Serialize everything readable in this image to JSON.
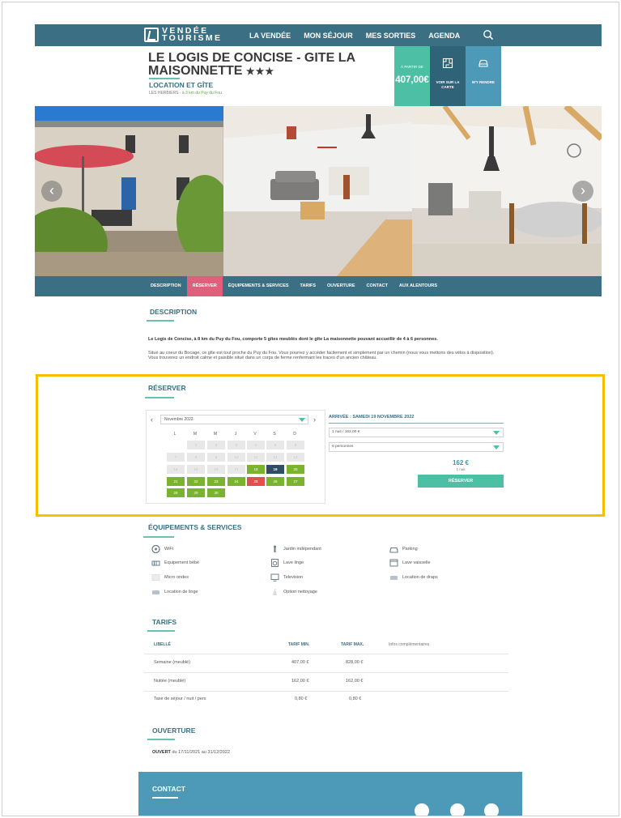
{
  "nav": {
    "logo_line1": "VENDÉE",
    "logo_line2": "TOURISME",
    "items": [
      "LA VENDÉE",
      "MON SÉJOUR",
      "MES SORTIES",
      "AGENDA"
    ]
  },
  "header": {
    "title": "LE LOGIS DE CONCISE - GITE LA MAISONNETTE",
    "stars": "★★★",
    "category": "LOCATION ET GÎTE",
    "location": "LES HERBIERS",
    "distance": " - à 3 km du Puy du Fou"
  },
  "boxes": {
    "price_label": "À PARTIR DE",
    "price_value": "407,00€",
    "map_label": "VOIR SUR LA CARTE",
    "go_label": "M'Y RENDRE"
  },
  "tabs": [
    "DESCRIPTION",
    "RÉSERVER",
    "ÉQUIPEMENTS & SERVICES",
    "TARIFS",
    "OUVERTURE",
    "CONTACT",
    "AUX ALENTOURS"
  ],
  "description": {
    "title": "DESCRIPTION",
    "lead": "Le Logis de Concise, à 8 km du Puy du Fou, comporte 5 gîtes meublés dont le gîte La maisonnette pouvant accueillir de 4 à 6 personnes.",
    "body1": "Situé au coeur du Bocage, ce gîte est tout proche du Puy du Fou. Vous pourrez y accéder facilement et simplement par un chemin (nous vous mettons des vélos à disposition).",
    "body2": "Vous trouverez un endroit calme et paisible situé dans un corps de ferme renfermant les traces d'un ancien château."
  },
  "reserve": {
    "title": "RÉSERVER",
    "month": "Novembre 2022",
    "weekdays": [
      "L",
      "M",
      "M",
      "J",
      "V",
      "S",
      "D"
    ],
    "arrival": "ARRIVÉE : SAMEDI 19 NOVEMBRE 2022",
    "nights": "1 nuit / 162,00 €",
    "persons": "6 personnes",
    "total": "162 €",
    "total_sub": "1 nuit",
    "button": "RÉSERVER"
  },
  "equipment": {
    "title": "ÉQUIPEMENTS & SERVICES",
    "items": [
      {
        "label": "WiFi",
        "icon": "wifi-icon"
      },
      {
        "label": "Jardin indépendant",
        "icon": "garden-icon"
      },
      {
        "label": "Parking",
        "icon": "car-icon"
      },
      {
        "label": "Equipement bébé",
        "icon": "baby-bed-icon"
      },
      {
        "label": "Lave linge",
        "icon": "washing-machine-icon"
      },
      {
        "label": "Lave vaisselle",
        "icon": "dishwasher-icon"
      },
      {
        "label": "Micro ondes",
        "icon": "microwave-icon"
      },
      {
        "label": "Television",
        "icon": "tv-icon"
      },
      {
        "label": "Location de draps",
        "icon": "sheets-icon"
      },
      {
        "label": "Location de linge",
        "icon": "linen-icon"
      },
      {
        "label": "Option nettoyage",
        "icon": "cleaning-icon"
      }
    ]
  },
  "tarifs": {
    "title": "TARIFS",
    "headers": [
      "LIBELLÉ",
      "TARIF MIN.",
      "TARIF MAX.",
      "Infos complémentaires"
    ],
    "rows": [
      [
        "Semaine (meublé)",
        "407,00 €",
        "828,00 €"
      ],
      [
        "Nuitée (meublé)",
        "162,00 €",
        "162,00 €"
      ],
      [
        "Taxe de séjour / nuit / pers",
        "0,80 €",
        "0,80 €"
      ]
    ]
  },
  "ouverture": {
    "title": "OUVERTURE",
    "label": "OUVERT",
    "period": " du 17/11/2021 au 31/12/2022"
  },
  "contact": {
    "title": "CONTACT"
  },
  "colors": {
    "nav": "#3b6f83",
    "accent": "#4dbfa5",
    "tab_active": "#e15f7a",
    "highlight": "#f5c000",
    "available": "#7ab32e"
  }
}
